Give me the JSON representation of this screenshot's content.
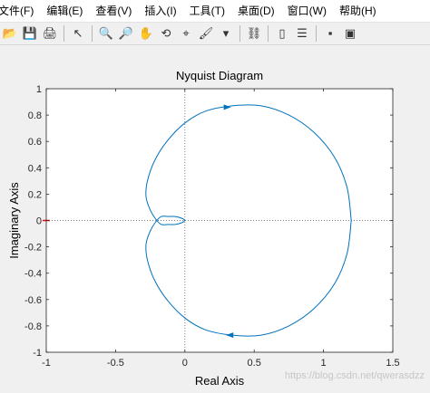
{
  "menus": [
    "文件(F)",
    "编辑(E)",
    "查看(V)",
    "插入(I)",
    "工具(T)",
    "桌面(D)",
    "窗口(W)",
    "帮助(H)"
  ],
  "toolbar": [
    {
      "name": "open-icon",
      "glyph": "📂"
    },
    {
      "name": "save-icon",
      "glyph": "💾"
    },
    {
      "name": "print-icon",
      "glyph": "🖨"
    },
    {
      "sep": true
    },
    {
      "name": "pointer-icon",
      "glyph": "↖"
    },
    {
      "sep": true
    },
    {
      "name": "zoom-in-icon",
      "glyph": "🔍"
    },
    {
      "name": "zoom-out-icon",
      "glyph": "🔎"
    },
    {
      "name": "pan-icon",
      "glyph": "✋"
    },
    {
      "name": "rotate-icon",
      "glyph": "⟲"
    },
    {
      "name": "data-cursor-icon",
      "glyph": "⌖"
    },
    {
      "name": "brush-icon",
      "glyph": "🖌"
    },
    {
      "name": "dropdown-icon",
      "glyph": "▾"
    },
    {
      "sep": true
    },
    {
      "name": "link-icon",
      "glyph": "⛓"
    },
    {
      "sep": true
    },
    {
      "name": "colorbar-icon",
      "glyph": "▯"
    },
    {
      "name": "legend-icon",
      "glyph": "☰"
    },
    {
      "sep": true
    },
    {
      "name": "hide-tools-icon",
      "glyph": "▪"
    },
    {
      "name": "show-tools-icon",
      "glyph": "▣"
    }
  ],
  "colors": {
    "curve": "#0072bd",
    "marker": "#ff0000",
    "axes": "#262626",
    "grid": "#808080"
  },
  "chart_data": {
    "type": "line",
    "title": "Nyquist Diagram",
    "xlabel": "Real Axis",
    "ylabel": "Imaginary Axis",
    "xlim": [
      -1,
      1.5
    ],
    "ylim": [
      -1,
      1
    ],
    "xticks": [
      -1,
      -0.5,
      0,
      0.5,
      1,
      1.5
    ],
    "xtick_labels": [
      "-1",
      "-0.5",
      "0",
      "0.5",
      "1",
      "1.5"
    ],
    "yticks": [
      -1,
      -0.8,
      -0.6,
      -0.4,
      -0.2,
      0,
      0.2,
      0.4,
      0.6,
      0.8,
      1
    ],
    "ytick_labels": [
      "-1",
      "-0.8",
      "-0.6",
      "-0.4",
      "-0.2",
      "0",
      "0.2",
      "0.4",
      "0.6",
      "0.8",
      "1"
    ],
    "critical_point": [
      -1,
      0
    ],
    "series": [
      {
        "x": [
          1.2,
          1.17,
          1.08,
          0.93,
          0.75,
          0.55,
          0.34,
          0.15,
          0.0,
          -0.13,
          -0.22,
          -0.27,
          -0.28,
          -0.25,
          -0.21,
          -0.17,
          -0.12,
          -0.07,
          -0.03,
          -0.01,
          0.0
        ],
        "y": [
          0.0,
          0.25,
          0.48,
          0.67,
          0.8,
          0.87,
          0.87,
          0.83,
          0.74,
          0.6,
          0.45,
          0.3,
          0.18,
          0.08,
          0.01,
          -0.03,
          -0.03,
          -0.03,
          -0.02,
          -0.01,
          0.0
        ]
      }
    ],
    "arrows": [
      [
        0.3,
        0.86
      ],
      [
        0.33,
        -0.87
      ]
    ],
    "grid": false,
    "reference_lines": [
      {
        "axis": "y",
        "value": 0
      },
      {
        "axis": "x",
        "value": 0
      }
    ]
  },
  "watermark": "https://blog.csdn.net/qwerasdzz"
}
